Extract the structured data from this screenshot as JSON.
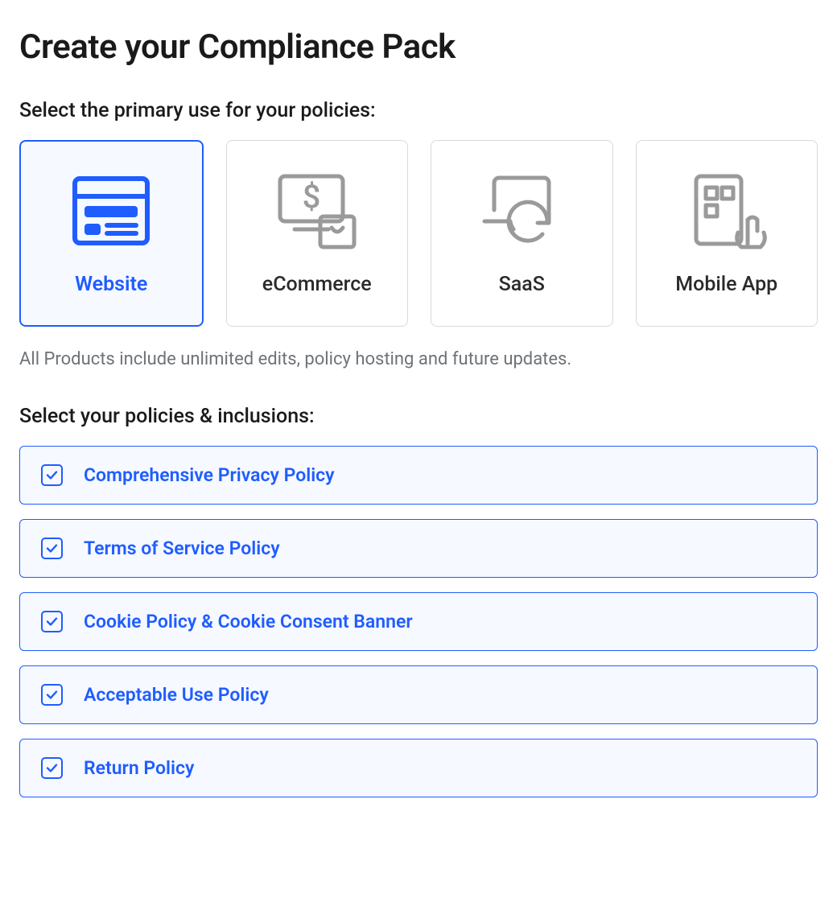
{
  "title": "Create your Compliance Pack",
  "primary_use": {
    "label": "Select the primary use for your policies:",
    "options": [
      {
        "id": "website",
        "label": "Website",
        "selected": true
      },
      {
        "id": "ecommerce",
        "label": "eCommerce",
        "selected": false
      },
      {
        "id": "saas",
        "label": "SaaS",
        "selected": false
      },
      {
        "id": "mobile",
        "label": "Mobile App",
        "selected": false
      }
    ],
    "note": "All Products include unlimited edits, policy hosting and future updates."
  },
  "policies": {
    "label": "Select your policies & inclusions:",
    "items": [
      {
        "label": "Comprehensive Privacy Policy",
        "checked": true
      },
      {
        "label": "Terms of Service Policy",
        "checked": true
      },
      {
        "label": "Cookie Policy & Cookie Consent Banner",
        "checked": true
      },
      {
        "label": "Acceptable Use Policy",
        "checked": true
      },
      {
        "label": "Return Policy",
        "checked": true
      }
    ]
  }
}
